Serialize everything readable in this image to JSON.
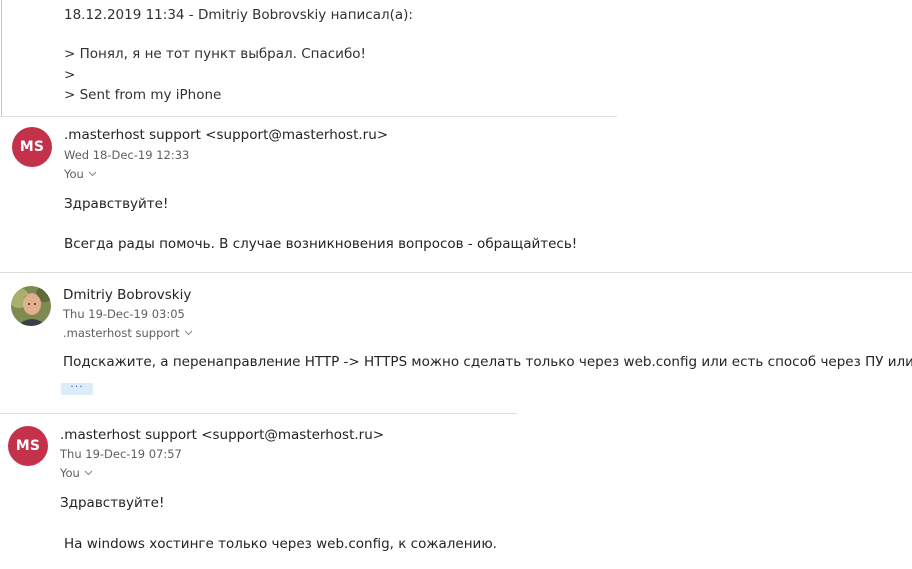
{
  "quote": {
    "header": "18.12.2019 11:34 - Dmitriy Bobrovskiy написал(а):",
    "lines": [
      "> Понял, я не тот пункт выбрал. Спасибо!",
      ">",
      "> Sent from my iPhone"
    ]
  },
  "messages": [
    {
      "avatar_initials": "MS",
      "sender": ".masterhost support <support@masterhost.ru>",
      "date": "Wed 18-Dec-19 12:33",
      "to": "You",
      "body": [
        "Здравствуйте!",
        "Всегда рады помочь. В случае возникновения вопросов - обращайтесь!"
      ]
    },
    {
      "avatar_initials": "",
      "sender": "Dmitriy Bobrovskiy",
      "date": "Thu 19-Dec-19 03:05",
      "to": ".masterhost support",
      "body": [
        "Подскажите, а перенаправление HTTP -> HTTPS можно сделать только через web.config или есть способ через ПУ или вас?"
      ],
      "more_label": "···"
    },
    {
      "avatar_initials": "MS",
      "sender": ".masterhost support <support@masterhost.ru>",
      "date": "Thu 19-Dec-19 07:57",
      "to": "You",
      "body": [
        "Здравствуйте!",
        "На windows хостинге только через web.config, к сожалению."
      ]
    }
  ],
  "colors": {
    "avatar_bg": "#c4314b",
    "separator": "#e1dfdd",
    "more_button_bg": "#deecf9"
  }
}
